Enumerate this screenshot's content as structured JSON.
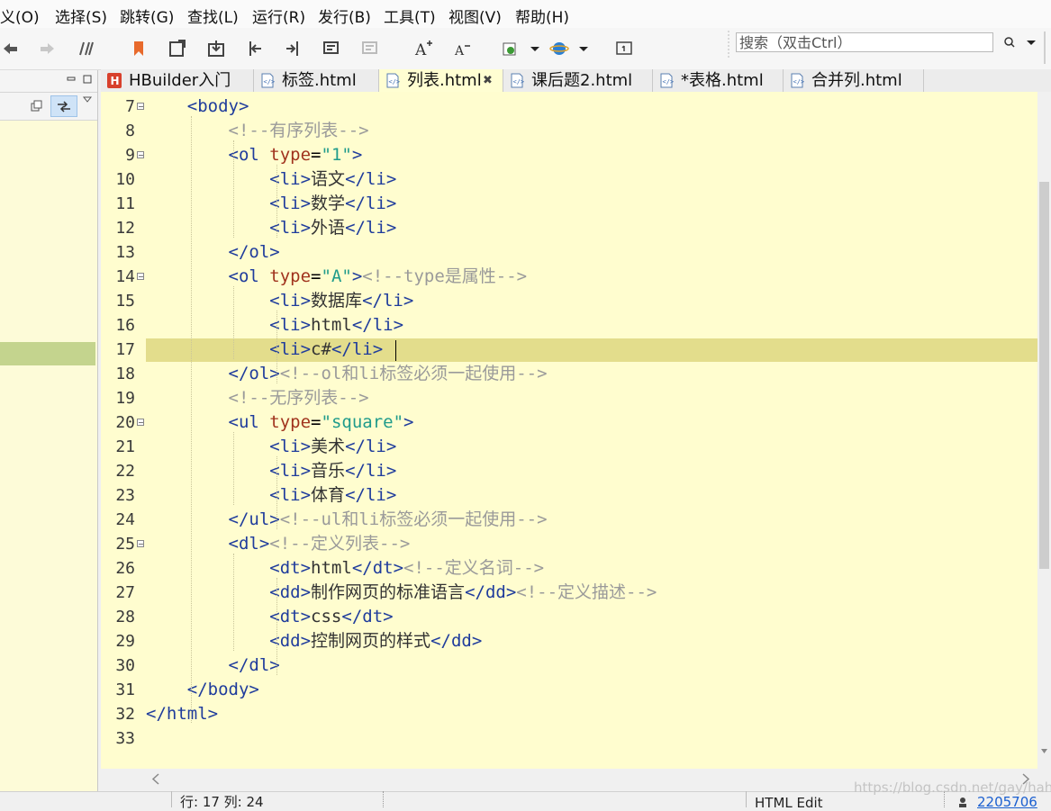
{
  "menu": [
    "义(O)",
    "选择(S)",
    "跳转(G)",
    "查找(L)",
    "运行(R)",
    "发行(B)",
    "工具(T)",
    "视图(V)",
    "帮助(H)"
  ],
  "search": {
    "placeholder": "搜索（双击Ctrl）"
  },
  "tabs": [
    {
      "label": "HBuilder入门",
      "icon": "hbuilder-icon"
    },
    {
      "label": "标签.html",
      "icon": "html-file-icon"
    },
    {
      "label": "列表.html",
      "icon": "html-file-icon",
      "active": true
    },
    {
      "label": "课后题2.html",
      "icon": "html-file-icon"
    },
    {
      "label": "*表格.html",
      "icon": "html-file-icon"
    },
    {
      "label": "合并列.html",
      "icon": "html-file-icon"
    }
  ],
  "editor": {
    "line_numbers": [
      "7",
      "8",
      "9",
      "10",
      "11",
      "12",
      "13",
      "14",
      "15",
      "16",
      "17",
      "18",
      "19",
      "20",
      "21",
      "22",
      "23",
      "24",
      "25",
      "26",
      "27",
      "28",
      "29",
      "30",
      "31",
      "32",
      "33"
    ],
    "lines": [
      [
        {
          "t": "    "
        },
        {
          "c": "tag",
          "t": "<body>"
        }
      ],
      [
        {
          "t": "        "
        },
        {
          "c": "cmt",
          "t": "<!--有序列表-->"
        }
      ],
      [
        {
          "t": "        "
        },
        {
          "c": "tag",
          "t": "<ol "
        },
        {
          "c": "attr",
          "t": "type"
        },
        {
          "t": "="
        },
        {
          "c": "str",
          "t": "\"1\""
        },
        {
          "c": "tag",
          "t": ">"
        }
      ],
      [
        {
          "t": "            "
        },
        {
          "c": "tag",
          "t": "<li>"
        },
        {
          "c": "txt",
          "t": "语文"
        },
        {
          "c": "tag",
          "t": "</li>"
        }
      ],
      [
        {
          "t": "            "
        },
        {
          "c": "tag",
          "t": "<li>"
        },
        {
          "c": "txt",
          "t": "数学"
        },
        {
          "c": "tag",
          "t": "</li>"
        }
      ],
      [
        {
          "t": "            "
        },
        {
          "c": "tag",
          "t": "<li>"
        },
        {
          "c": "txt",
          "t": "外语"
        },
        {
          "c": "tag",
          "t": "</li>"
        }
      ],
      [
        {
          "t": "        "
        },
        {
          "c": "tag",
          "t": "</ol>"
        }
      ],
      [
        {
          "t": "        "
        },
        {
          "c": "tag",
          "t": "<ol "
        },
        {
          "c": "attr",
          "t": "type"
        },
        {
          "t": "="
        },
        {
          "c": "str",
          "t": "\"A\""
        },
        {
          "c": "tag",
          "t": ">"
        },
        {
          "c": "cmt",
          "t": "<!--type是属性-->"
        }
      ],
      [
        {
          "t": "            "
        },
        {
          "c": "tag",
          "t": "<li>"
        },
        {
          "c": "txt",
          "t": "数据库"
        },
        {
          "c": "tag",
          "t": "</li>"
        }
      ],
      [
        {
          "t": "            "
        },
        {
          "c": "tag",
          "t": "<li>"
        },
        {
          "c": "txt",
          "t": "html"
        },
        {
          "c": "tag",
          "t": "</li>"
        }
      ],
      [
        {
          "t": "            "
        },
        {
          "c": "tag",
          "t": "<li>"
        },
        {
          "c": "txt",
          "t": "c#"
        },
        {
          "c": "tag",
          "t": "</li>"
        }
      ],
      [
        {
          "t": "        "
        },
        {
          "c": "tag",
          "t": "</ol>"
        },
        {
          "c": "cmt",
          "t": "<!--ol和li标签必须一起使用-->"
        }
      ],
      [
        {
          "t": "        "
        },
        {
          "c": "cmt",
          "t": "<!--无序列表-->"
        }
      ],
      [
        {
          "t": "        "
        },
        {
          "c": "tag",
          "t": "<ul "
        },
        {
          "c": "attr",
          "t": "type"
        },
        {
          "t": "="
        },
        {
          "c": "str",
          "t": "\"square\""
        },
        {
          "c": "tag",
          "t": ">"
        }
      ],
      [
        {
          "t": "            "
        },
        {
          "c": "tag",
          "t": "<li>"
        },
        {
          "c": "txt",
          "t": "美术"
        },
        {
          "c": "tag",
          "t": "</li>"
        }
      ],
      [
        {
          "t": "            "
        },
        {
          "c": "tag",
          "t": "<li>"
        },
        {
          "c": "txt",
          "t": "音乐"
        },
        {
          "c": "tag",
          "t": "</li>"
        }
      ],
      [
        {
          "t": "            "
        },
        {
          "c": "tag",
          "t": "<li>"
        },
        {
          "c": "txt",
          "t": "体育"
        },
        {
          "c": "tag",
          "t": "</li>"
        }
      ],
      [
        {
          "t": "        "
        },
        {
          "c": "tag",
          "t": "</ul>"
        },
        {
          "c": "cmt",
          "t": "<!--ul和li标签必须一起使用-->"
        }
      ],
      [
        {
          "t": "        "
        },
        {
          "c": "tag",
          "t": "<dl>"
        },
        {
          "c": "cmt",
          "t": "<!--定义列表-->"
        }
      ],
      [
        {
          "t": "            "
        },
        {
          "c": "tag",
          "t": "<dt>"
        },
        {
          "c": "txt",
          "t": "html"
        },
        {
          "c": "tag",
          "t": "</dt>"
        },
        {
          "c": "cmt",
          "t": "<!--定义名词-->"
        }
      ],
      [
        {
          "t": "            "
        },
        {
          "c": "tag",
          "t": "<dd>"
        },
        {
          "c": "txt",
          "t": "制作网页的标准语言"
        },
        {
          "c": "tag",
          "t": "</dd>"
        },
        {
          "c": "cmt",
          "t": "<!--定义描述-->"
        }
      ],
      [
        {
          "t": "            "
        },
        {
          "c": "tag",
          "t": "<dt>"
        },
        {
          "c": "txt",
          "t": "css"
        },
        {
          "c": "tag",
          "t": "</dt>"
        }
      ],
      [
        {
          "t": "            "
        },
        {
          "c": "tag",
          "t": "<dd>"
        },
        {
          "c": "txt",
          "t": "控制网页的样式"
        },
        {
          "c": "tag",
          "t": "</dd>"
        }
      ],
      [
        {
          "t": "        "
        },
        {
          "c": "tag",
          "t": "</dl>"
        }
      ],
      [
        {
          "t": "    "
        },
        {
          "c": "tag",
          "t": "</body>"
        }
      ],
      [
        {
          "c": "tag",
          "t": "</html>"
        }
      ],
      []
    ],
    "fold_lines": [
      "7",
      "9",
      "14",
      "20",
      "25"
    ],
    "current_line": "17"
  },
  "status": {
    "position": "行: 17 列: 24",
    "mode": "HTML Edit",
    "extra": "2205706"
  },
  "watermark": "https://blog.csdn.net/gay/hahh"
}
